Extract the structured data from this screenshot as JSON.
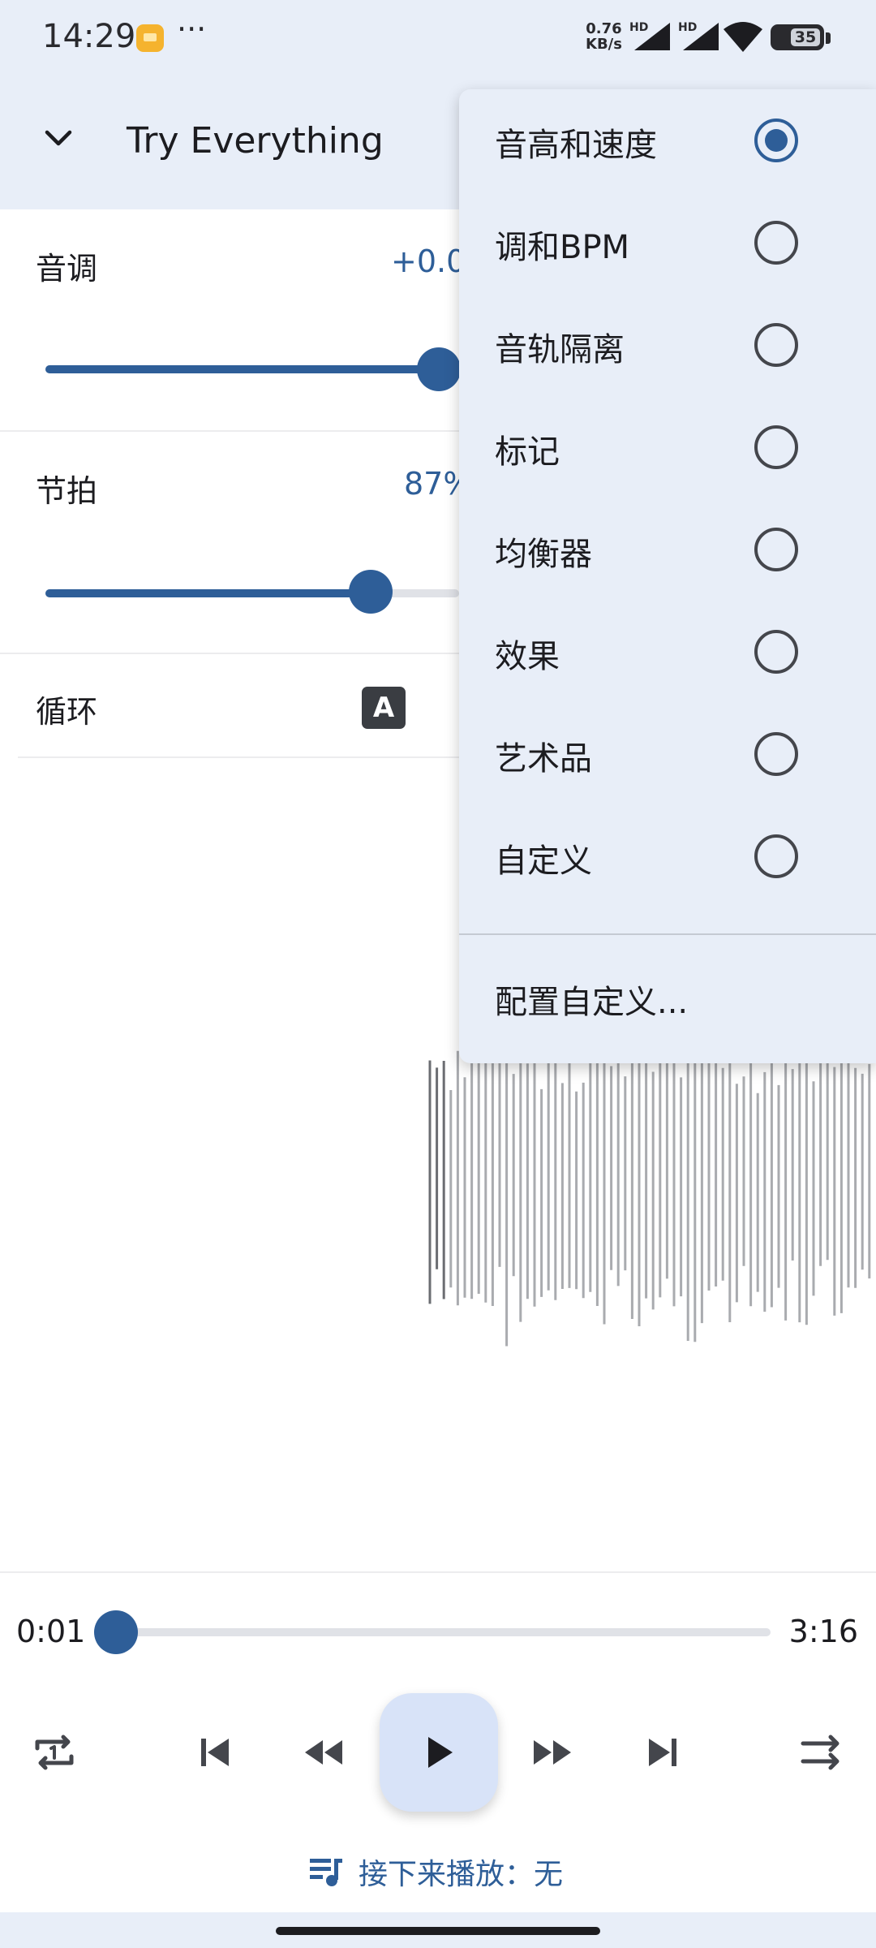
{
  "status_bar": {
    "time": "14:29",
    "dots": "···",
    "net_speed_value": "0.76",
    "net_speed_unit": "KB/s",
    "hd_label": "HD",
    "battery_level": "35"
  },
  "header": {
    "title": "Try Everything",
    "back_icon": "chevron-down-icon"
  },
  "controls": {
    "pitch": {
      "label": "音调",
      "value": "+0.0",
      "level": 0.95
    },
    "tempo": {
      "label": "节拍",
      "value": "87%",
      "level": 0.75
    },
    "loop": {
      "label": "循环",
      "badge": "A"
    }
  },
  "player": {
    "position": "0:01",
    "duration": "3:16",
    "progress": 0.005,
    "up_next": "接下来播放：无"
  },
  "menu": {
    "items": [
      {
        "label": "音高和速度",
        "checked": true
      },
      {
        "label": "调和BPM",
        "checked": false
      },
      {
        "label": "音轨隔离",
        "checked": false
      },
      {
        "label": "标记",
        "checked": false
      },
      {
        "label": "均衡器",
        "checked": false
      },
      {
        "label": "效果",
        "checked": false
      },
      {
        "label": "艺术品",
        "checked": false
      },
      {
        "label": "自定义",
        "checked": false
      }
    ],
    "configure": "配置自定义..."
  },
  "colors": {
    "accent": "#2e5e98",
    "surface_tint": "#e8eef8",
    "play_button_bg": "#d8e3f8"
  }
}
